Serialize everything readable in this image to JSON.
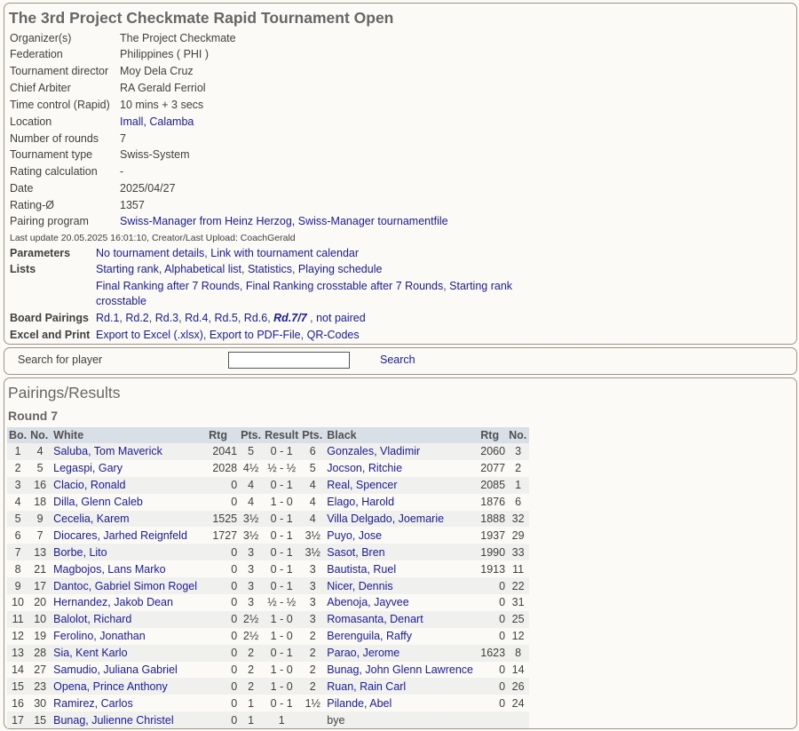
{
  "title": "The 3rd Project Checkmate Rapid Tournament Open",
  "info": [
    {
      "label": "Organizer(s)",
      "value": "The Project Checkmate",
      "link": false
    },
    {
      "label": "Federation",
      "value": "Philippines ( PHI )",
      "link": false
    },
    {
      "label": "Tournament director",
      "value": "Moy Dela Cruz",
      "link": false
    },
    {
      "label": "Chief Arbiter",
      "value": "RA Gerald Ferriol",
      "link": false
    },
    {
      "label": "Time control (Rapid)",
      "value": "10 mins + 3 secs",
      "link": false
    },
    {
      "label": "Location",
      "value": "Imall, Calamba",
      "link": true
    },
    {
      "label": "Number of rounds",
      "value": "7",
      "link": false
    },
    {
      "label": "Tournament type",
      "value": "Swiss-System",
      "link": false
    },
    {
      "label": "Rating calculation",
      "value": "-",
      "link": false
    },
    {
      "label": "Date",
      "value": "2025/04/27",
      "link": false
    },
    {
      "label": "Rating-Ø",
      "value": "1357",
      "link": false
    },
    {
      "label": "Pairing program",
      "value": "Swiss-Manager from Heinz Herzog, Swiss-Manager tournamentfile",
      "link": true
    }
  ],
  "last_update": "Last update 20.05.2025 16:01:10, Creator/Last Upload: CoachGerald",
  "parameters": {
    "label": "Parameters",
    "links": [
      "No tournament details",
      "Link with tournament calendar"
    ]
  },
  "lists": {
    "label": "Lists",
    "line1": [
      "Starting rank",
      "Alphabetical list",
      "Statistics",
      "Playing schedule"
    ],
    "line2": [
      "Final Ranking after 7 Rounds",
      "Final Ranking crosstable after 7 Rounds",
      "Starting rank"
    ],
    "line3": "crosstable"
  },
  "board_pairings": {
    "label": "Board Pairings",
    "rounds": [
      "Rd.1",
      "Rd.2",
      "Rd.3",
      "Rd.4",
      "Rd.5",
      "Rd.6"
    ],
    "current": "Rd.7/7",
    "not_paired": "not paired"
  },
  "excel_print": {
    "label": "Excel and Print",
    "links": [
      "Export to Excel (.xlsx)",
      "Export to PDF-File",
      "QR-Codes"
    ]
  },
  "search": {
    "label": "Search for player",
    "value": "",
    "button": "Search"
  },
  "pairings_heading": "Pairings/Results",
  "round_heading": "Round 7",
  "table_headers": {
    "bo": "Bo.",
    "no": "No.",
    "white": "White",
    "rtg": "Rtg",
    "pts": "Pts.",
    "result": "Result",
    "bpts": "Pts.",
    "black": "Black",
    "brtg": "Rtg",
    "bno": "No."
  },
  "rows": [
    {
      "bo": "1",
      "no": "4",
      "white": "Saluba, Tom Maverick",
      "rtg": "2041",
      "pts": "5",
      "result": "0 - 1",
      "bpts": "6",
      "black": "Gonzales, Vladimir",
      "brtg": "2060",
      "bno": "3"
    },
    {
      "bo": "2",
      "no": "5",
      "white": "Legaspi, Gary",
      "rtg": "2028",
      "pts": "4½",
      "result": "½ - ½",
      "bpts": "5",
      "black": "Jocson, Ritchie",
      "brtg": "2077",
      "bno": "2"
    },
    {
      "bo": "3",
      "no": "16",
      "white": "Clacio, Ronald",
      "rtg": "0",
      "pts": "4",
      "result": "0 - 1",
      "bpts": "4",
      "black": "Real, Spencer",
      "brtg": "2085",
      "bno": "1"
    },
    {
      "bo": "4",
      "no": "18",
      "white": "Dilla, Glenn Caleb",
      "rtg": "0",
      "pts": "4",
      "result": "1 - 0",
      "bpts": "4",
      "black": "Elago, Harold",
      "brtg": "1876",
      "bno": "6"
    },
    {
      "bo": "5",
      "no": "9",
      "white": "Cecelia, Karem",
      "rtg": "1525",
      "pts": "3½",
      "result": "0 - 1",
      "bpts": "4",
      "black": "Villa Delgado, Joemarie",
      "brtg": "1888",
      "bno": "32"
    },
    {
      "bo": "6",
      "no": "7",
      "white": "Diocares, Jarhed Reignfeld",
      "rtg": "1727",
      "pts": "3½",
      "result": "0 - 1",
      "bpts": "3½",
      "black": "Puyo, Jose",
      "brtg": "1937",
      "bno": "29"
    },
    {
      "bo": "7",
      "no": "13",
      "white": "Borbe, Lito",
      "rtg": "0",
      "pts": "3",
      "result": "0 - 1",
      "bpts": "3½",
      "black": "Sasot, Bren",
      "brtg": "1990",
      "bno": "33"
    },
    {
      "bo": "8",
      "no": "21",
      "white": "Magbojos, Lans Marko",
      "rtg": "0",
      "pts": "3",
      "result": "0 - 1",
      "bpts": "3",
      "black": "Bautista, Ruel",
      "brtg": "1913",
      "bno": "11"
    },
    {
      "bo": "9",
      "no": "17",
      "white": "Dantoc, Gabriel Simon Rogel",
      "rtg": "0",
      "pts": "3",
      "result": "0 - 1",
      "bpts": "3",
      "black": "Nicer, Dennis",
      "brtg": "0",
      "bno": "22"
    },
    {
      "bo": "10",
      "no": "20",
      "white": "Hernandez, Jakob Dean",
      "rtg": "0",
      "pts": "3",
      "result": "½ - ½",
      "bpts": "3",
      "black": "Abenoja, Jayvee",
      "brtg": "0",
      "bno": "31"
    },
    {
      "bo": "11",
      "no": "10",
      "white": "Balolot, Richard",
      "rtg": "0",
      "pts": "2½",
      "result": "1 - 0",
      "bpts": "3",
      "black": "Romasanta, Denart",
      "brtg": "0",
      "bno": "25"
    },
    {
      "bo": "12",
      "no": "19",
      "white": "Ferolino, Jonathan",
      "rtg": "0",
      "pts": "2½",
      "result": "1 - 0",
      "bpts": "2",
      "black": "Berenguila, Raffy",
      "brtg": "0",
      "bno": "12"
    },
    {
      "bo": "13",
      "no": "28",
      "white": "Sia, Kent Karlo",
      "rtg": "0",
      "pts": "2",
      "result": "0 - 1",
      "bpts": "2",
      "black": "Parao, Jerome",
      "brtg": "1623",
      "bno": "8"
    },
    {
      "bo": "14",
      "no": "27",
      "white": "Samudio, Juliana Gabriel",
      "rtg": "0",
      "pts": "2",
      "result": "1 - 0",
      "bpts": "2",
      "black": "Bunag, John Glenn Lawrence",
      "brtg": "0",
      "bno": "14"
    },
    {
      "bo": "15",
      "no": "23",
      "white": "Opena, Prince Anthony",
      "rtg": "0",
      "pts": "2",
      "result": "1 - 0",
      "bpts": "2",
      "black": "Ruan, Rain Carl",
      "brtg": "0",
      "bno": "26"
    },
    {
      "bo": "16",
      "no": "30",
      "white": "Ramirez, Carlos",
      "rtg": "0",
      "pts": "1",
      "result": "0 - 1",
      "bpts": "1½",
      "black": "Pilande, Abel",
      "brtg": "0",
      "bno": "24"
    },
    {
      "bo": "17",
      "no": "15",
      "white": "Bunag, Julienne Christel",
      "rtg": "0",
      "pts": "1",
      "result": "1",
      "bpts": "",
      "black": "bye",
      "brtg": "",
      "bno": "",
      "black_link": false
    }
  ]
}
